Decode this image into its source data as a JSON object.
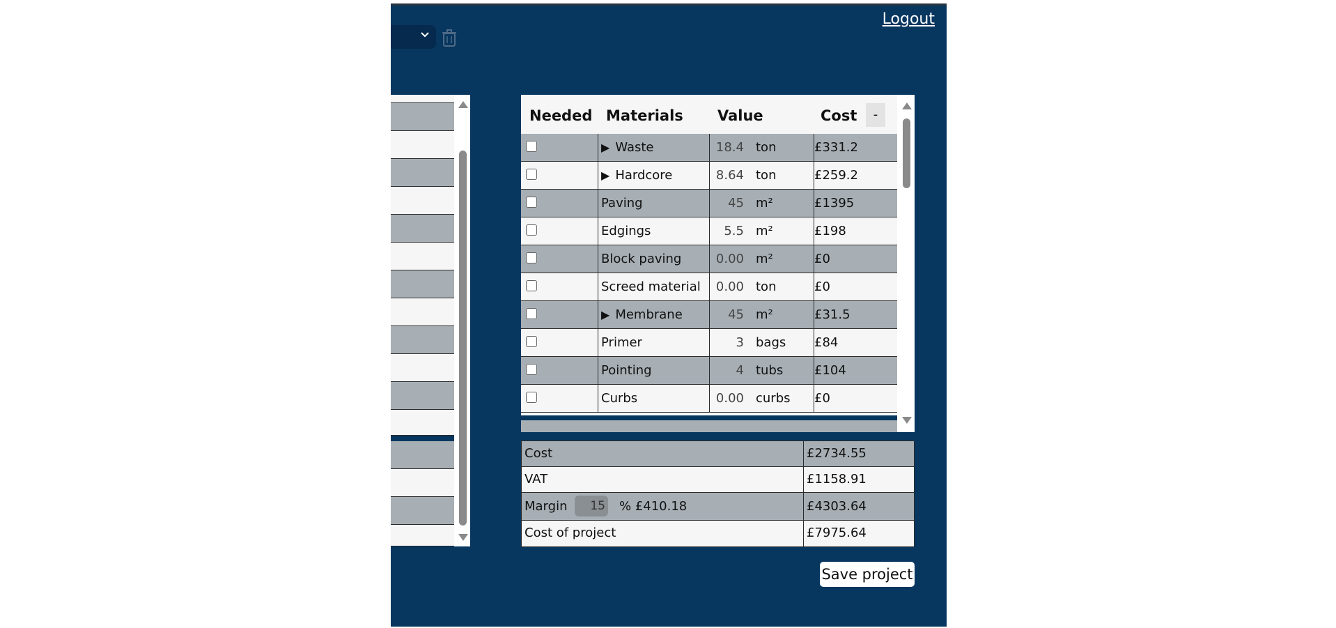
{
  "header": {
    "logout_label": "Logout"
  },
  "icons": {
    "dropdown": "chevron-down-icon",
    "delete": "trash-icon",
    "expand": "triangle-right-icon"
  },
  "colors": {
    "app_background": "#07365f",
    "row_grey": "#a7afb5",
    "row_white": "#f6f6f6"
  },
  "materials": {
    "headers": {
      "needed": "Needed",
      "materials": "Materials",
      "value": "Value",
      "cost": "Cost"
    },
    "collapse_label": "-",
    "rows": [
      {
        "expandable": true,
        "name": "Waste",
        "value": "18.4",
        "unit": "ton",
        "cost": "£331.2"
      },
      {
        "expandable": true,
        "name": "Hardcore",
        "value": "8.64",
        "unit": "ton",
        "cost": "£259.2"
      },
      {
        "expandable": false,
        "name": "Paving",
        "value": "45",
        "unit": "m²",
        "cost": "£1395"
      },
      {
        "expandable": false,
        "name": "Edgings",
        "value": "5.5",
        "unit": "m²",
        "cost": "£198"
      },
      {
        "expandable": false,
        "name": "Block paving",
        "value": "0.00",
        "unit": "m²",
        "cost": "£0"
      },
      {
        "expandable": false,
        "name": "Screed material",
        "value": "0.00",
        "unit": "ton",
        "cost": "£0"
      },
      {
        "expandable": true,
        "name": "Membrane",
        "value": "45",
        "unit": "m²",
        "cost": "£31.5"
      },
      {
        "expandable": false,
        "name": "Primer",
        "value": "3",
        "unit": "bags",
        "cost": "£84"
      },
      {
        "expandable": false,
        "name": "Pointing",
        "value": "4",
        "unit": "tubs",
        "cost": "£104"
      },
      {
        "expandable": false,
        "name": "Curbs",
        "value": "0.00",
        "unit": "curbs",
        "cost": "£0"
      }
    ]
  },
  "summary": {
    "cost_label": "Cost",
    "cost_value": "£2734.55",
    "vat_label": "VAT",
    "vat_value": "£1158.91",
    "margin_label": "Margin",
    "margin_percent": "15",
    "margin_amount_text": "% £410.18",
    "margin_value": "£4303.64",
    "project_label": "Cost of project",
    "project_value": "£7975.64"
  },
  "save_label": "Save project"
}
